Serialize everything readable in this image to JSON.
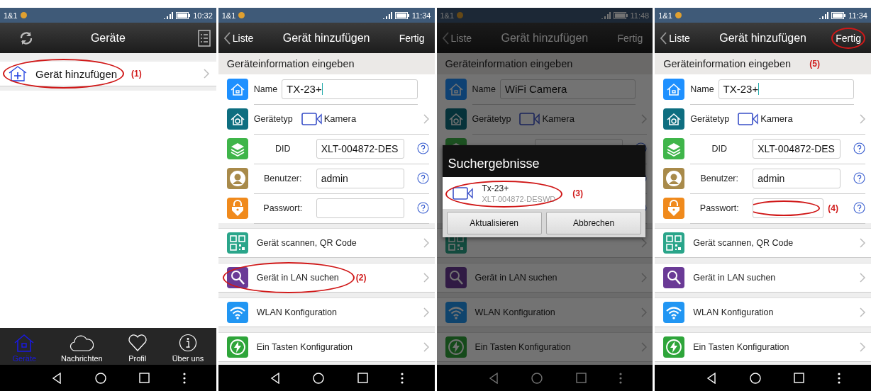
{
  "screens": [
    {
      "kind": "devices",
      "status_bar": {
        "carrier": "1&1",
        "time": "10:32"
      },
      "header": {
        "title": "Geräte"
      },
      "items": [
        {
          "label": "Gerät hinzufügen",
          "annotation": "(1)"
        }
      ],
      "tab_bar": [
        {
          "label": "Geräte",
          "selected": true
        },
        {
          "label": "Nachrichten",
          "selected": false
        },
        {
          "label": "Profil",
          "selected": false
        },
        {
          "label": "Über uns",
          "selected": false
        }
      ]
    },
    {
      "kind": "form",
      "dimmed": false,
      "status_bar": {
        "carrier": "1&1",
        "time": "11:34"
      },
      "header": {
        "back": "Liste",
        "title": "Gerät hinzufügen",
        "action": "Fertig"
      },
      "section_title": "Geräteinformation eingeben",
      "fields": [
        {
          "kind": "plain",
          "label": "Name",
          "value": "TX-23+",
          "focused": true
        },
        {
          "kind": "select",
          "label": "Gerätetyp",
          "value": "Kamera"
        },
        {
          "kind": "help",
          "label": "DID",
          "value": "XLT-004872-DES",
          "focused": false
        },
        {
          "kind": "help",
          "label": "Benutzer:",
          "value": "admin",
          "focused": false
        },
        {
          "kind": "help",
          "label": "Passwort:",
          "focused": false
        }
      ],
      "actions": [
        {
          "kind": "qr",
          "label": "Gerät scannen, QR Code"
        },
        {
          "kind": "search",
          "label": "Gerät in LAN suchen",
          "annotation": "(2)"
        },
        {
          "kind": "wifi",
          "label": "WLAN Konfiguration"
        },
        {
          "kind": "bolt",
          "label": "Ein Tasten Konfiguration"
        }
      ]
    },
    {
      "kind": "form",
      "dimmed": true,
      "status_bar": {
        "carrier": "1&1",
        "time": "11:48"
      },
      "header": {
        "back": "Liste",
        "title": "Gerät hinzufügen",
        "action": "Fertig"
      },
      "section_title": "Geräteinformation eingeben",
      "fields": [
        {
          "kind": "plain",
          "label": "Name",
          "value": "WiFi Camera",
          "focused": false
        },
        {
          "kind": "select",
          "label": "Gerätetyp",
          "value": "Kamera"
        },
        {
          "kind": "help"
        },
        {
          "kind": "help"
        },
        {
          "kind": "help"
        }
      ],
      "actions": [
        {
          "kind": "qr"
        },
        {
          "kind": "search",
          "label": "Gerät in LAN suchen"
        },
        {
          "kind": "wifi",
          "label": "WLAN Konfiguration"
        },
        {
          "kind": "bolt",
          "label": "Ein Tasten Konfiguration"
        }
      ],
      "dialog": {
        "title": "Suchergebnisse",
        "results": [
          {
            "name": "Tx-23+",
            "id": "XLT-004872-DESWD",
            "annotation": "(3)"
          }
        ],
        "buttons": [
          "Aktualisieren",
          "Abbrechen"
        ]
      }
    },
    {
      "kind": "form",
      "dimmed": false,
      "status_bar": {
        "carrier": "1&1",
        "time": "11:34"
      },
      "header": {
        "back": "Liste",
        "title": "Gerät hinzufügen",
        "action": "Fertig",
        "annotation": "(5)"
      },
      "section_title": "Geräteinformation eingeben",
      "fields": [
        {
          "kind": "plain",
          "label": "Name",
          "value": "TX-23+",
          "focused": true
        },
        {
          "kind": "select",
          "label": "Gerätetyp",
          "value": "Kamera"
        },
        {
          "kind": "help",
          "label": "DID",
          "value": "XLT-004872-DES",
          "focused": false
        },
        {
          "kind": "help",
          "label": "Benutzer:",
          "value": "admin",
          "focused": false
        },
        {
          "kind": "help",
          "label": "Passwort:",
          "focused": false,
          "annotation": "(4)"
        }
      ],
      "actions": [
        {
          "kind": "qr",
          "label": "Gerät scannen, QR Code"
        },
        {
          "kind": "search",
          "label": "Gerät in LAN suchen"
        },
        {
          "kind": "wifi",
          "label": "WLAN Konfiguration"
        },
        {
          "kind": "bolt",
          "label": "Ein Tasten Konfiguration"
        }
      ]
    }
  ]
}
